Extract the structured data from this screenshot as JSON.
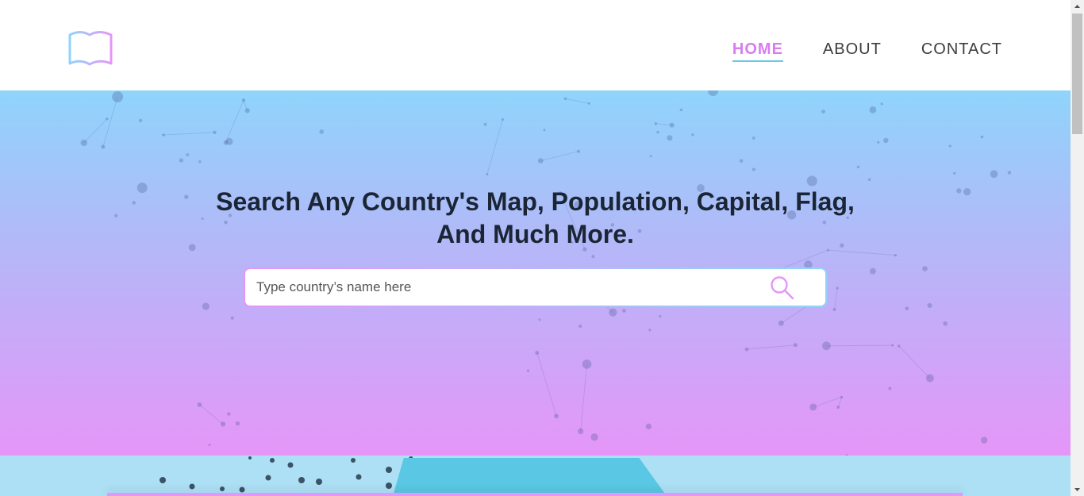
{
  "header": {
    "logo_icon": "book-icon",
    "nav": [
      {
        "label": "HOME",
        "active": true
      },
      {
        "label": "ABOUT",
        "active": false
      },
      {
        "label": "CONTACT",
        "active": false
      }
    ]
  },
  "hero": {
    "title_line1": "Search Any Country's Map, Population, Capital, Flag,",
    "title_line2": "And Much More.",
    "background_icon": "world-network-map",
    "search": {
      "placeholder": "Type country’s name here",
      "value": "",
      "icon": "search-icon"
    }
  },
  "colors": {
    "accent_pink": "#e596f8",
    "accent_blue": "#8fd4fb",
    "title_text": "#1b2535"
  }
}
